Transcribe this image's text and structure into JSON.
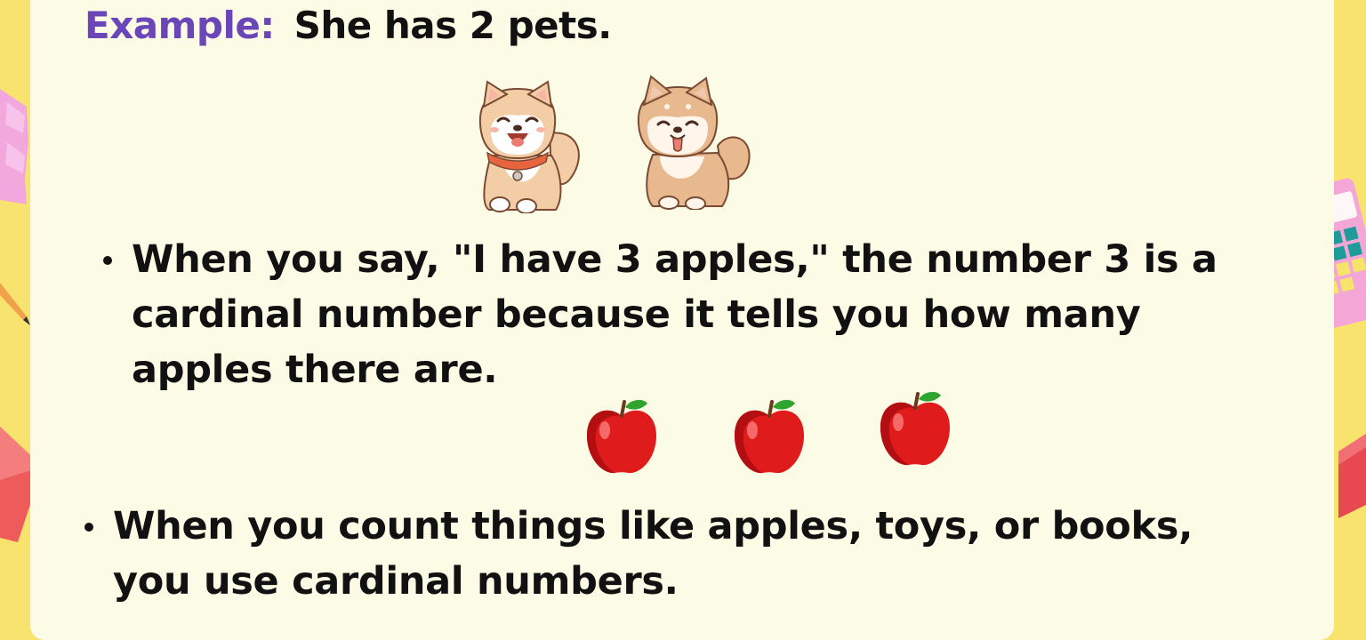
{
  "example": {
    "label": "Example:",
    "sentence": "She has 2 pets."
  },
  "bullets": [
    "When you say, \"I have 3 apples,\" the number 3 is a cardinal number because it tells you how many apples there are.",
    "When you count things like apples, toys, or books, you use cardinal numbers."
  ],
  "illustrations": {
    "dogs": [
      "shiba-dog-icon",
      "shiba-dog-icon"
    ],
    "apples": [
      "apple-icon",
      "apple-icon",
      "apple-icon"
    ]
  },
  "colors": {
    "background": "#f8e36f",
    "card": "#fcfbe6",
    "example_label": "#6b46b8",
    "text": "#111111"
  }
}
